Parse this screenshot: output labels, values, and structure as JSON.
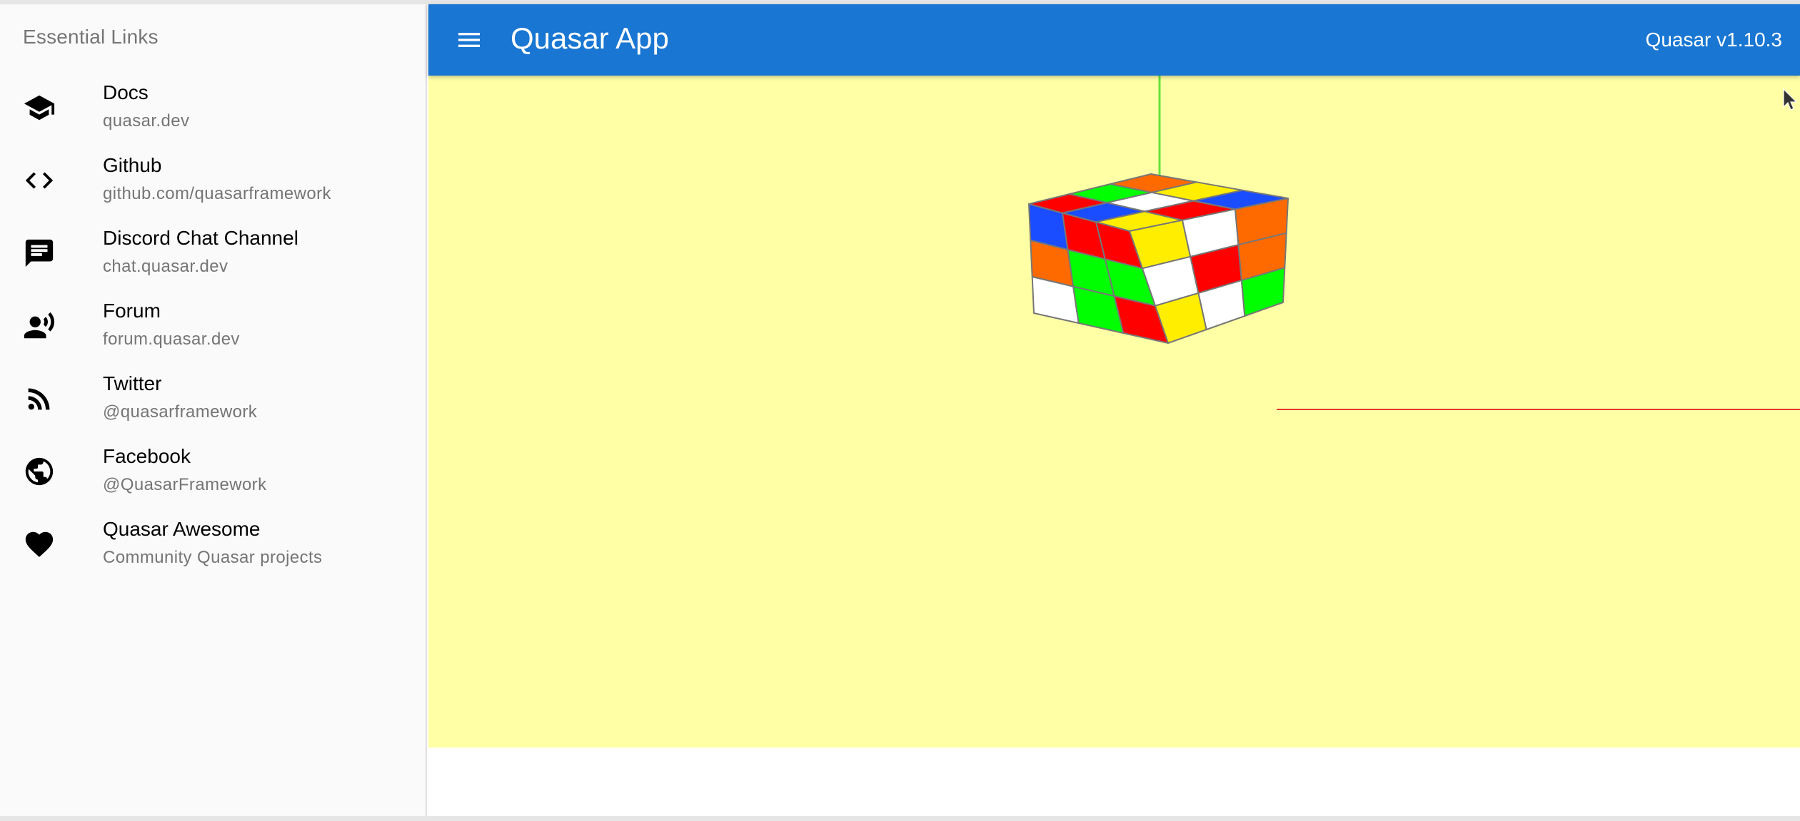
{
  "drawer": {
    "header": "Essential Links",
    "links": [
      {
        "title": "Docs",
        "caption": "quasar.dev",
        "icon": "school-icon"
      },
      {
        "title": "Github",
        "caption": "github.com/quasarframework",
        "icon": "code-icon"
      },
      {
        "title": "Discord Chat Channel",
        "caption": "chat.quasar.dev",
        "icon": "chat-icon"
      },
      {
        "title": "Forum",
        "caption": "forum.quasar.dev",
        "icon": "record-voice-icon"
      },
      {
        "title": "Twitter",
        "caption": "@quasarframework",
        "icon": "rss-feed-icon"
      },
      {
        "title": "Facebook",
        "caption": "@QuasarFramework",
        "icon": "public-icon"
      },
      {
        "title": "Quasar Awesome",
        "caption": "Community Quasar projects",
        "icon": "favorite-icon"
      }
    ]
  },
  "header": {
    "title": "Quasar App",
    "version": "Quasar v1.10.3",
    "background_color": "#1976d2",
    "menu_icon": "menu-icon"
  },
  "scene": {
    "background_color": "#ffffa5",
    "object": "rubiks-cube",
    "axis_colors": {
      "y": "#66e23a",
      "x": "#e53935"
    },
    "cube_colors": {
      "red": "#ff0000",
      "green": "#00ff00",
      "blue": "#1a4dff",
      "yellow": "#ffee00",
      "white": "#ffffff",
      "orange": "#ff6a00"
    },
    "faces": {
      "top": [
        [
          "red",
          "green",
          "orange"
        ],
        [
          "blue",
          "white",
          "yellow"
        ],
        [
          "yellow",
          "red",
          "blue"
        ]
      ],
      "front": [
        [
          "blue",
          "red",
          "red"
        ],
        [
          "orange",
          "green",
          "green"
        ],
        [
          "white",
          "green",
          "red"
        ]
      ],
      "right": [
        [
          "yellow",
          "white",
          "orange"
        ],
        [
          "white",
          "red",
          "orange"
        ],
        [
          "yellow",
          "white",
          "green"
        ]
      ]
    }
  }
}
